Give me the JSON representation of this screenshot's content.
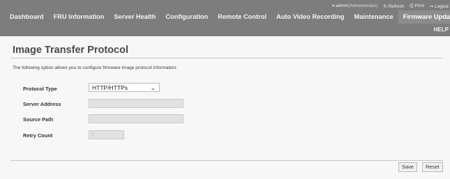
{
  "userbar": {
    "user": "admin",
    "role": "(Administrator)",
    "refresh": "Refresh",
    "print": "Print",
    "logout": "Logout"
  },
  "nav": [
    {
      "label": "Dashboard"
    },
    {
      "label": "FRU Information"
    },
    {
      "label": "Server Health"
    },
    {
      "label": "Configuration"
    },
    {
      "label": "Remote Control"
    },
    {
      "label": "Auto Video Recording"
    },
    {
      "label": "Maintenance"
    },
    {
      "label": "Firmware Update",
      "active": true
    }
  ],
  "help": "HELP",
  "page": {
    "title": "Image Transfer Protocol",
    "description": "The following option allows you to configure firmware image protocol information."
  },
  "form": {
    "protocol_type_label": "Protocol Type",
    "protocol_type_value": "HTTP/HTTPs",
    "server_address_label": "Server Address",
    "server_address_value": "",
    "source_path_label": "Source Path",
    "source_path_value": "",
    "retry_count_label": "Retry Count",
    "retry_count_value": "0"
  },
  "buttons": {
    "save": "Save",
    "reset": "Reset"
  },
  "colors": {
    "header": "#7d7d7d",
    "active_tab": "#8c8c8c",
    "background": "#f7f7f7"
  }
}
